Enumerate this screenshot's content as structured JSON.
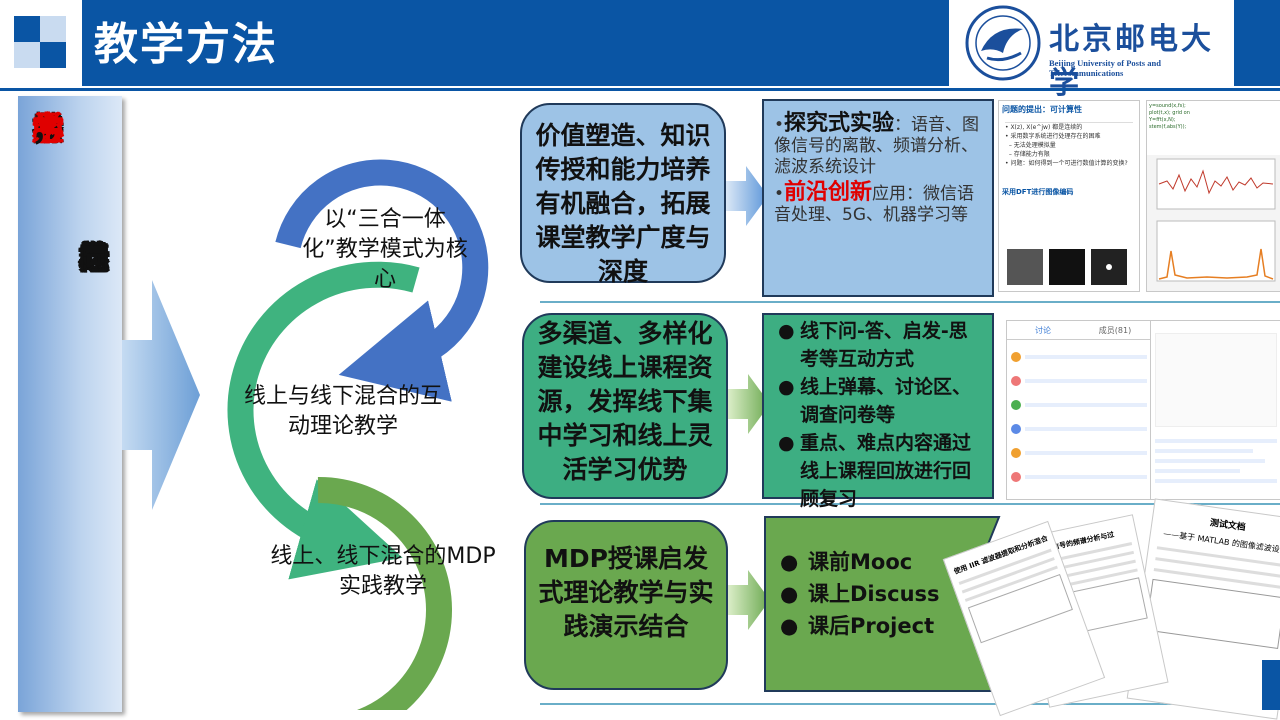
{
  "header": {
    "title": "教学方法",
    "university_name_cn": "北京邮电大学",
    "university_name_en": "Beijing University of Posts and Telecommunications"
  },
  "banner": {
    "col1": [
      {
        "text": "坚",
        "color": "#111111"
      },
      {
        "text": "持",
        "color": "#111111"
      },
      {
        "text": "质",
        "color": "#e00000"
      },
      {
        "text": "量",
        "color": "#e00000"
      },
      {
        "text": "为",
        "color": "#e00000"
      },
      {
        "text": "本",
        "color": "#e00000"
      },
      {
        "text": "，",
        "color": "#111111"
      },
      {
        "text": "以",
        "color": "#111111"
      },
      {
        "text": "学",
        "color": "#e00000"
      },
      {
        "text": "生",
        "color": "#e00000"
      },
      {
        "text": "为",
        "color": "#e00000"
      },
      {
        "text": "中",
        "color": "#e00000"
      },
      {
        "text": "心",
        "color": "#e00000"
      },
      {
        "text": "，",
        "color": "#111111"
      }
    ],
    "col2": [
      "以",
      "培",
      "养",
      "目",
      "标",
      "为",
      "导",
      "向"
    ]
  },
  "loops": {
    "top": "以“三合一体化”教学模式为核心",
    "middle": "线上与线下混合的互动理论教学",
    "bottom": "线上、线下混合的MDP实践教学"
  },
  "rows": [
    {
      "pill": "价值塑造、知识传授和能力培养有机融合，拓展课堂教学广度与深度",
      "pill_color": "#9dc3e6",
      "box_color": "#9dc3e6",
      "items": [
        {
          "bold": "探究式实验",
          "rest": "：语音、图像信号的离散、频谱分析、滤波系统设计",
          "accent": false
        },
        {
          "bold": "前沿创新",
          "rest": "应用：微信语音处理、5G、机器学习等",
          "accent": true
        }
      ]
    },
    {
      "pill": "多渠道、多样化建设线上课程资源，发挥线下集中学习和线上灵活学习优势",
      "pill_color": "#3dae82",
      "box_color": "#3dae82",
      "items": [
        {
          "text": "线下问-答、启发-思考等互动方式"
        },
        {
          "text": "线上弹幕、讨论区、调查问卷等"
        },
        {
          "text": "重点、难点内容通过线上课程回放进行回顾复习"
        }
      ]
    },
    {
      "pill": "MDP授课启发式理论教学与实践演示结合",
      "pill_color": "#6aa84f",
      "box_color": "#6aa84f",
      "items": [
        {
          "text": "课前Mooc"
        },
        {
          "text": "课上Discuss"
        },
        {
          "text": "课后Project"
        }
      ]
    }
  ],
  "thumbs": {
    "ppt_title": "问题的提出：可计算性",
    "ppt_subtitle": "采用DFT进行图像编码",
    "chat_tab1": "讨论",
    "chat_tab2": "成员(81)",
    "doc_title": "测试文档",
    "doc_subtitle": "——基于 MATLAB 的图像滤波设计",
    "doc2_title": "和弦信号的频谱分析与过",
    "doc3_title": "使用 IIR 滤波器提取和分析混合"
  },
  "colors": {
    "brand_blue": "#0a55a4",
    "accent_red": "#e00000"
  }
}
